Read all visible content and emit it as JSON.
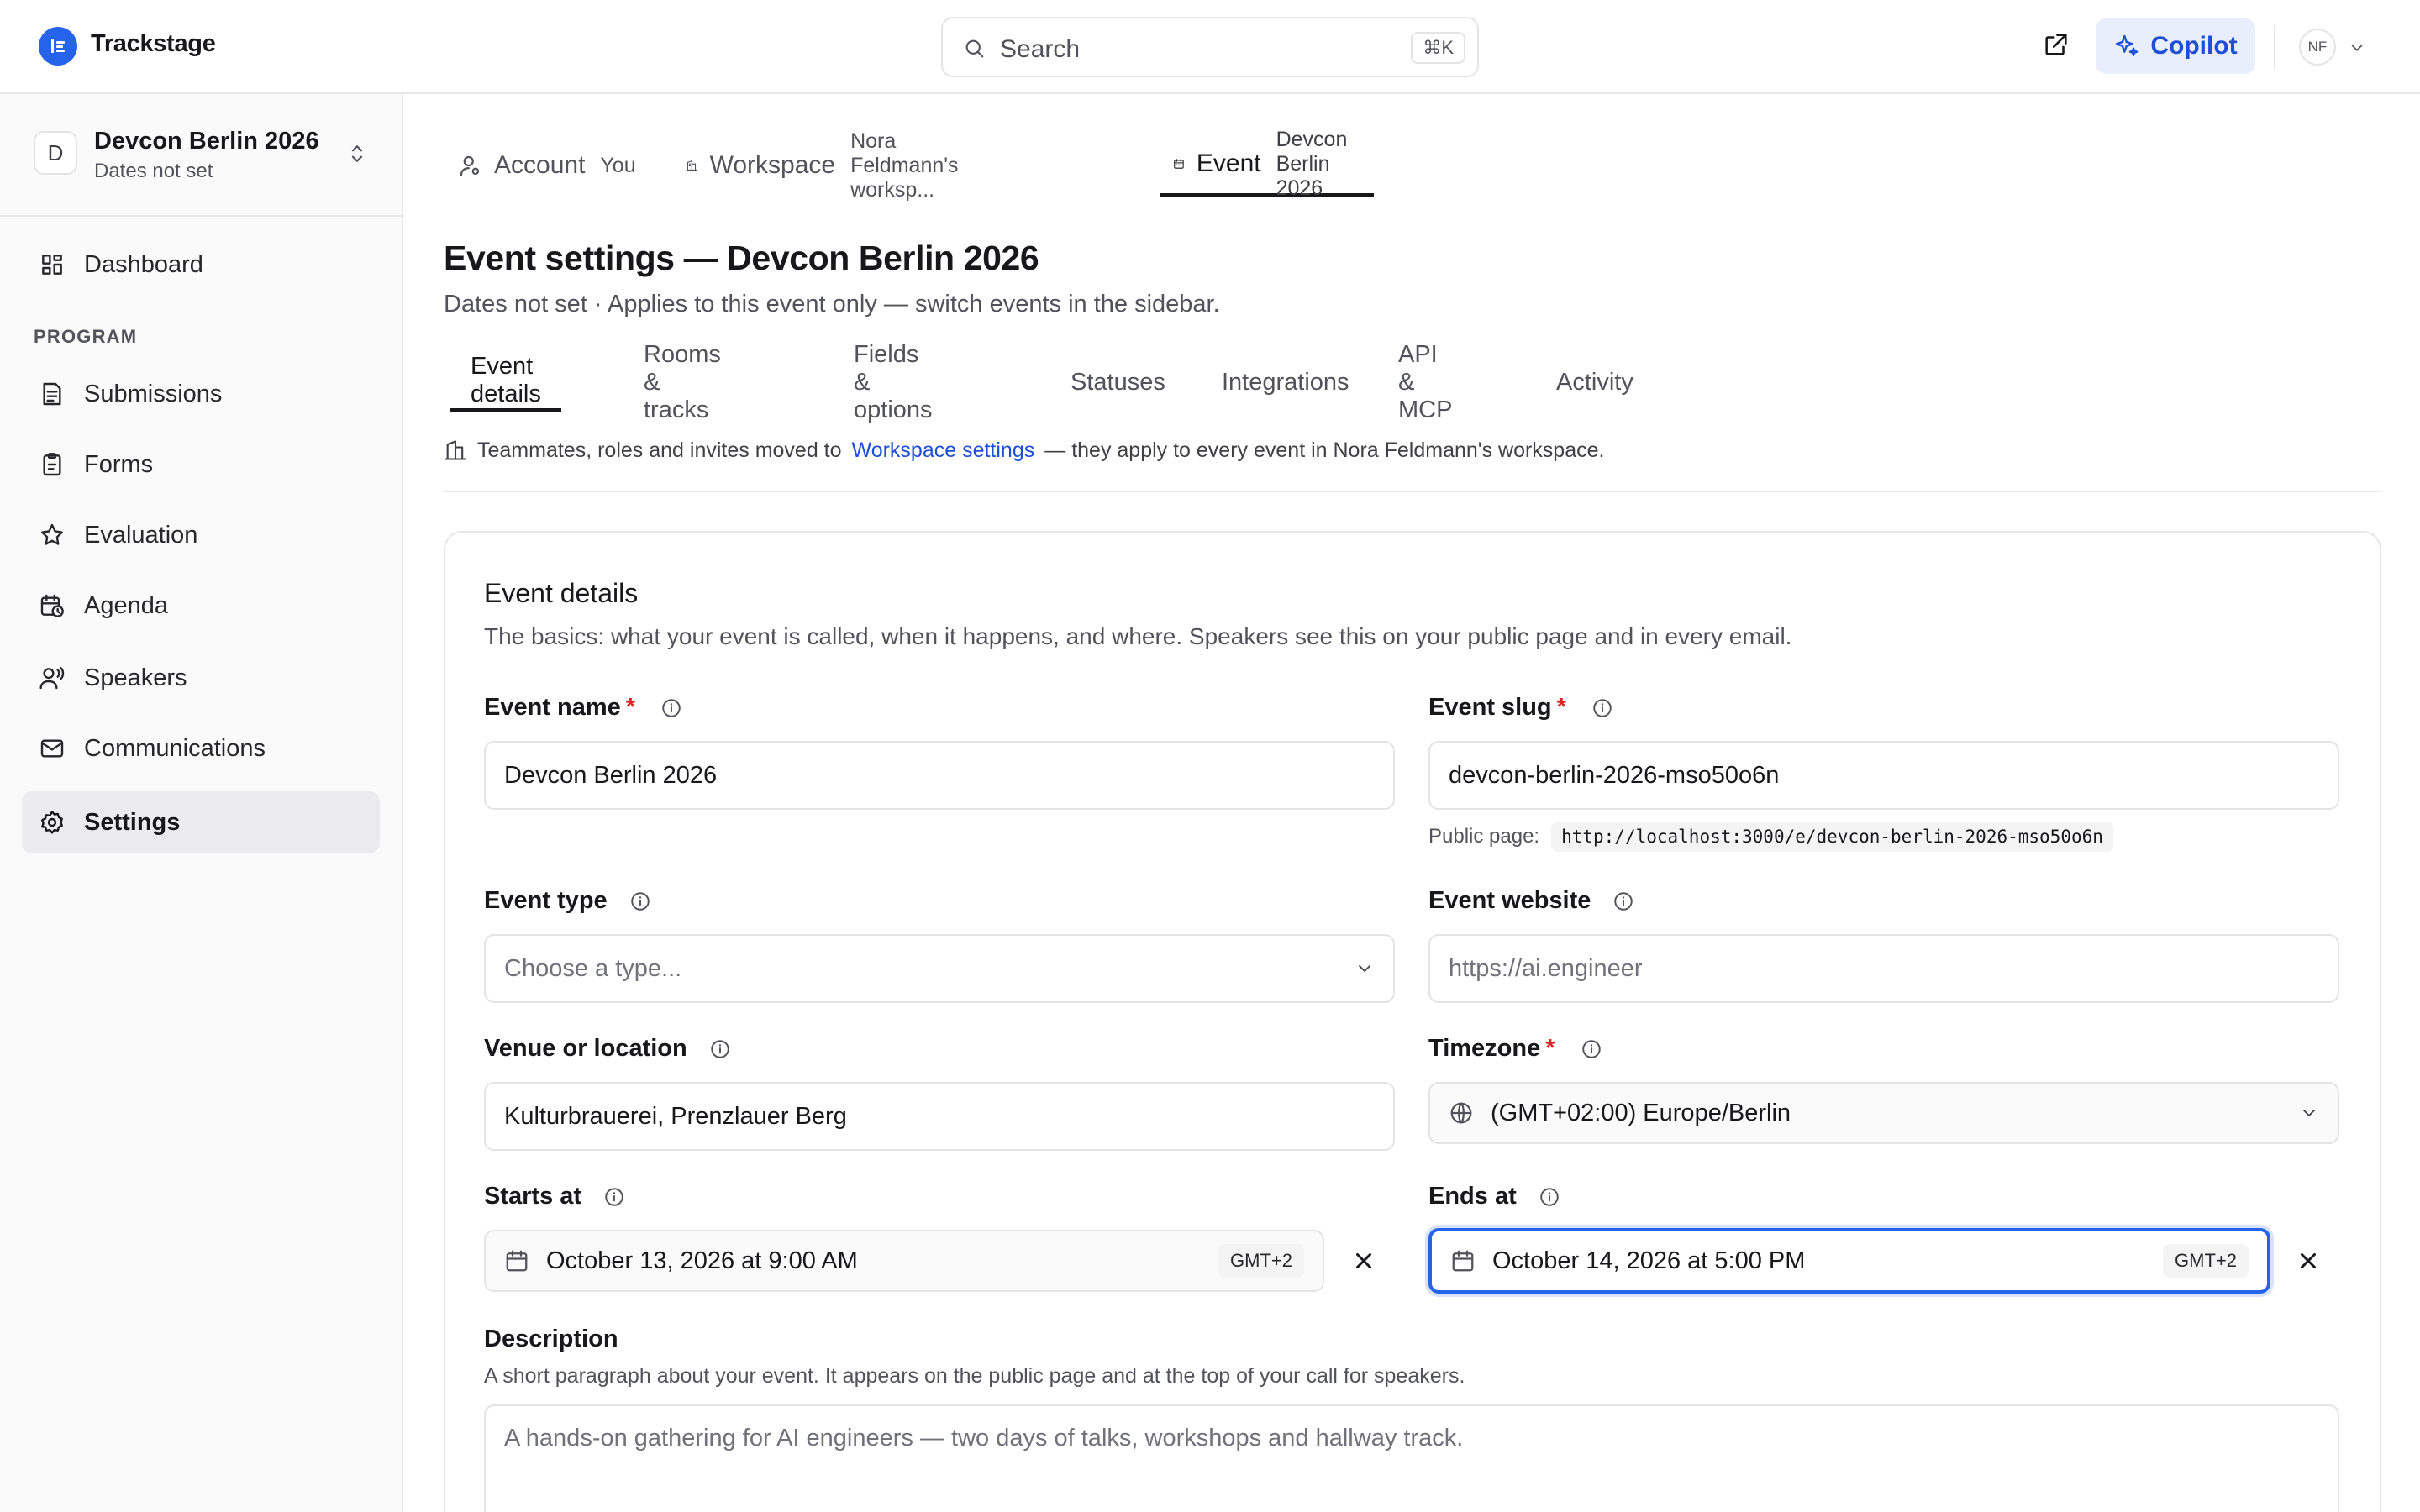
{
  "app": {
    "name": "Trackstage"
  },
  "search": {
    "placeholder": "Search",
    "shortcut": "⌘K"
  },
  "header": {
    "copilot_label": "Copilot",
    "user_initials": "NF"
  },
  "colors": {
    "accent": "#2563eb",
    "required": "#dc2626",
    "active_nav_bg": "#ececee"
  },
  "sidebar": {
    "event_switcher": {
      "initial": "D",
      "name": "Devcon Berlin 2026",
      "dates": "Dates not set"
    },
    "items": [
      {
        "label": "Dashboard",
        "icon": "dashboard-icon"
      },
      {
        "label": "Submissions",
        "icon": "submissions-icon"
      },
      {
        "label": "Forms",
        "icon": "clipboard-icon"
      },
      {
        "label": "Evaluation",
        "icon": "star-icon"
      },
      {
        "label": "Agenda",
        "icon": "calendar-clock-icon"
      },
      {
        "label": "Speakers",
        "icon": "speaker-icon"
      },
      {
        "label": "Communications",
        "icon": "mail-icon"
      },
      {
        "label": "Settings",
        "icon": "gear-icon",
        "active": true
      }
    ],
    "section_program": "PROGRAM"
  },
  "scope_tabs": [
    {
      "label": "Account",
      "sub": "You",
      "icon": "user-icon"
    },
    {
      "label": "Workspace",
      "sub": "Nora Feldmann's worksp...",
      "icon": "building-icon"
    },
    {
      "label": "Event",
      "sub": "Devcon Berlin 2026",
      "icon": "calendar-icon",
      "active": true
    }
  ],
  "page": {
    "title": "Event settings — Devcon Berlin 2026",
    "subtitle": "Dates not set · Applies to this event only — switch events in the sidebar."
  },
  "section_tabs": [
    {
      "label": "Event details",
      "active": true
    },
    {
      "label": "Rooms & tracks"
    },
    {
      "label": "Fields & options"
    },
    {
      "label": "Statuses"
    },
    {
      "label": "Integrations"
    },
    {
      "label": "API & MCP"
    },
    {
      "label": "Activity"
    }
  ],
  "notice": {
    "prefix": "Teammates, roles and invites moved to",
    "link": "Workspace settings",
    "suffix": "— they apply to every event in Nora Feldmann's workspace."
  },
  "card": {
    "title": "Event details",
    "description": "The basics: what your event is called, when it happens, and where. Speakers see this on your public page and in every email."
  },
  "fields": {
    "event_name": {
      "label": "Event name",
      "required": "*",
      "value": "Devcon Berlin 2026"
    },
    "event_slug": {
      "label": "Event slug",
      "required": "*",
      "value": "devcon-berlin-2026-mso50o6n"
    },
    "public_page": {
      "label": "Public page:",
      "url": "http://localhost:3000/e/devcon-berlin-2026-mso50o6n"
    },
    "event_type": {
      "label": "Event type",
      "placeholder": "Choose a type..."
    },
    "event_website": {
      "label": "Event website",
      "placeholder": "https://ai.engineer"
    },
    "venue": {
      "label": "Venue or location",
      "value": "Kulturbrauerei, Prenzlauer Berg"
    },
    "timezone": {
      "label": "Timezone",
      "required": "*",
      "value": "(GMT+02:00) Europe/Berlin"
    },
    "starts_at": {
      "label": "Starts at",
      "value": "October 13, 2026 at 9:00 AM",
      "tz": "GMT+2"
    },
    "ends_at": {
      "label": "Ends at",
      "value": "October 14, 2026 at 5:00 PM",
      "tz": "GMT+2"
    },
    "description": {
      "label": "Description",
      "help": "A short paragraph about your event. It appears on the public page and at the top of your call for speakers.",
      "placeholder": "A hands-on gathering for AI engineers — two days of talks, workshops and hallway track."
    }
  }
}
